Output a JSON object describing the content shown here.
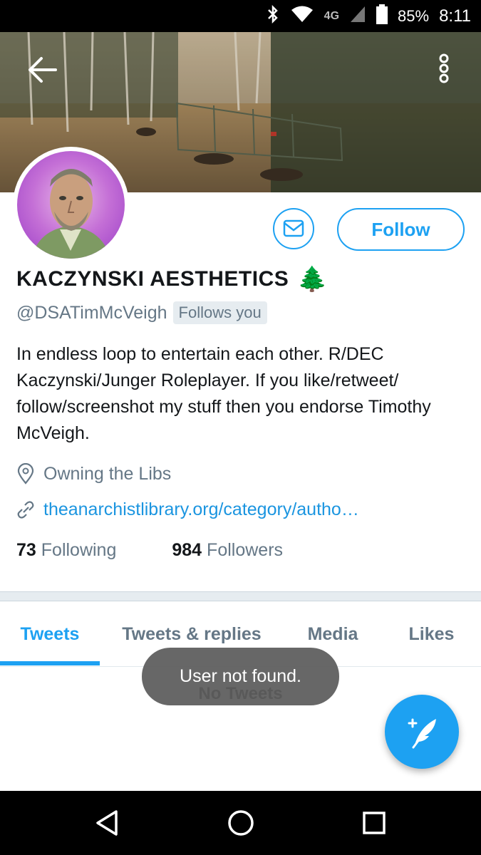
{
  "status_bar": {
    "network": "4G",
    "battery": "85%",
    "time": "8:11"
  },
  "profile": {
    "name": "KACZYNSKI AESTHETICS",
    "name_emoji": "🌲",
    "handle": "@DSATimMcVeigh",
    "follows_you": "Follows you",
    "bio": "In endless loop to entertain each other. R/DEC Kaczynski/Junger Roleplayer.  If you like/retweet/ follow/screenshot my stuff then you endorse Timothy McVeigh.",
    "location": "Owning the Libs",
    "url": "theanarchistlibrary.org/category/autho…",
    "following_count": "73",
    "following_label": "Following",
    "followers_count": "984",
    "followers_label": "Followers"
  },
  "actions": {
    "follow_label": "Follow"
  },
  "tabs": [
    {
      "label": "Tweets",
      "active": true
    },
    {
      "label": "Tweets & replies",
      "active": false
    },
    {
      "label": "Media",
      "active": false
    },
    {
      "label": "Likes",
      "active": false
    }
  ],
  "empty_state": "No Tweets",
  "toast": "User not found.",
  "colors": {
    "accent": "#1da1f2",
    "secondary_text": "#657786",
    "link": "#1b95e0"
  },
  "icons": {
    "back": "arrow-left-icon",
    "more": "more-vertical-icon",
    "dm": "envelope-icon",
    "location": "location-pin-icon",
    "url": "link-icon",
    "compose": "compose-feather-icon",
    "nav_back": "triangle-back-icon",
    "nav_home": "circle-home-icon",
    "nav_recents": "square-recents-icon"
  }
}
